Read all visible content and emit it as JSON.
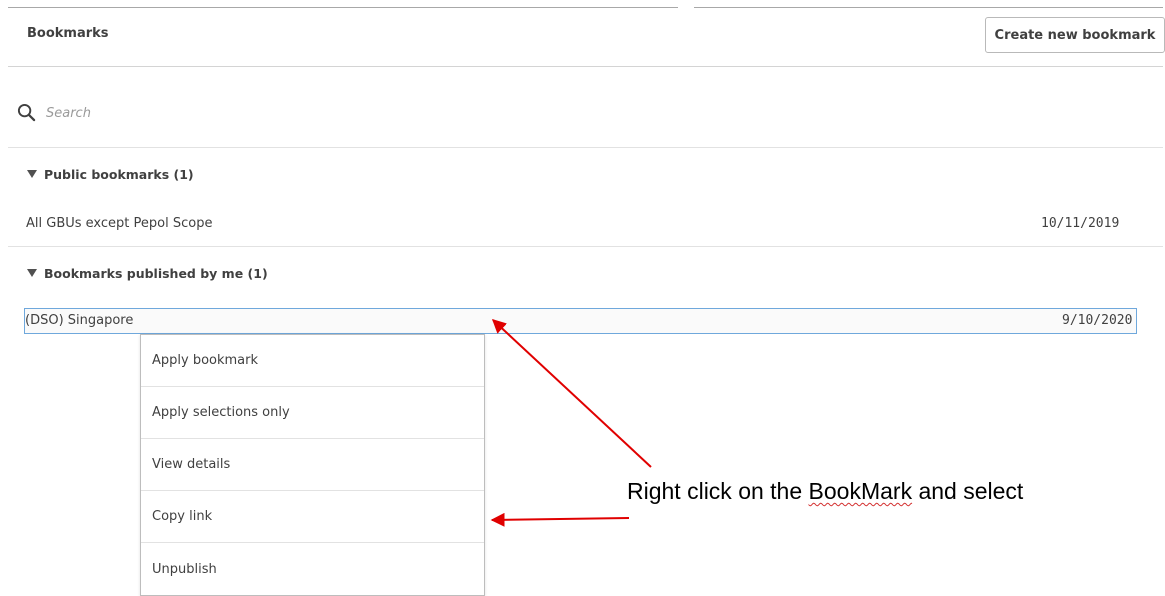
{
  "header": {
    "title": "Bookmarks",
    "create_button_label": "Create new bookmark"
  },
  "search": {
    "placeholder": "Search"
  },
  "sections": [
    {
      "label": "Public bookmarks (1)",
      "items": [
        {
          "name": "All GBUs except Pepol Scope",
          "date": "10/11/2019"
        }
      ]
    },
    {
      "label": "Bookmarks published by me (1)",
      "items": [
        {
          "name": "(DSO) Singapore",
          "date": "9/10/2020"
        }
      ]
    }
  ],
  "context_menu": {
    "items": [
      "Apply bookmark",
      "Apply selections only",
      "View details",
      "Copy link",
      "Unpublish"
    ]
  },
  "annotation": {
    "prefix": "Right click on the ",
    "word": "BookMark",
    "suffix": " and select"
  },
  "colors": {
    "selection_border": "#6fa8dc",
    "annotation_arrow": "#e00000"
  }
}
